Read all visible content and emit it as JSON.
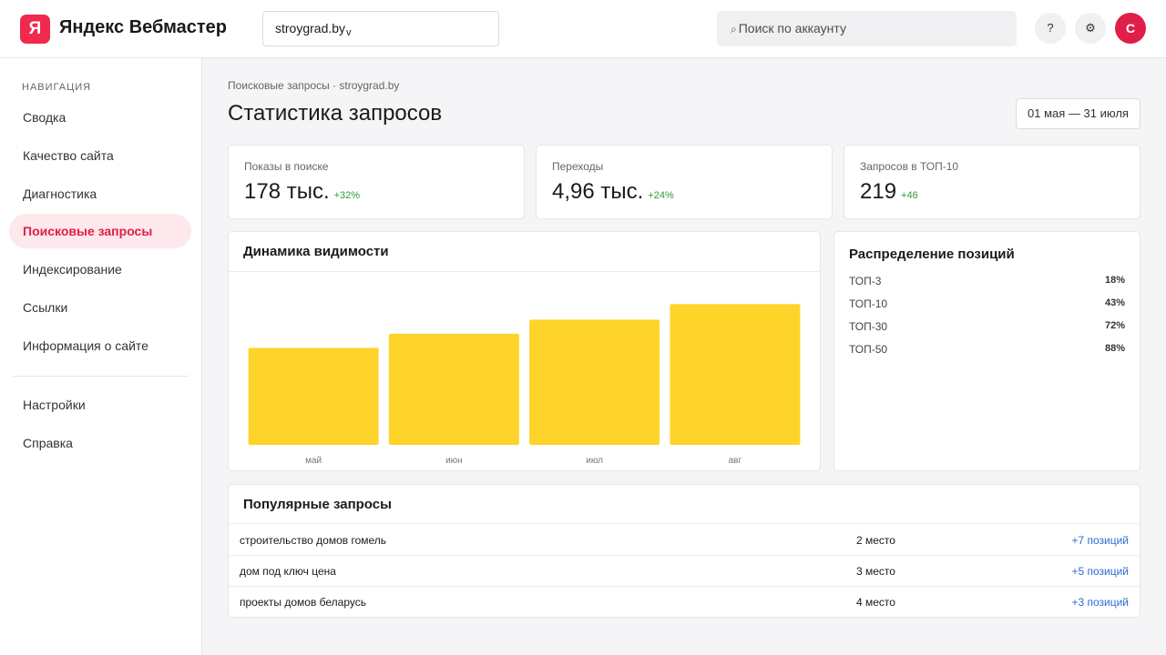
{
  "header": {
    "logo_letter": "Я",
    "app_title": "Яндекс Вебмастер",
    "site": "stroygrad.by",
    "site_chevron": "v",
    "search_icon": "⌕",
    "search_placeholder": "Поиск по аккаунту",
    "help_label": "?",
    "settings_icon": "⚙",
    "avatar_letter": "С"
  },
  "sidebar": {
    "heading": "НАВИГАЦИЯ",
    "items": [
      {
        "label": "Сводка",
        "active": false
      },
      {
        "label": "Качество сайта",
        "active": false
      },
      {
        "label": "Диагностика",
        "active": false
      },
      {
        "label": "Поисковые запросы",
        "active": true
      },
      {
        "label": "Индексирование",
        "active": false
      },
      {
        "label": "Ссылки",
        "active": false
      },
      {
        "label": "Информация о сайте",
        "active": false
      }
    ],
    "bottom_items": [
      {
        "label": "Настройки"
      },
      {
        "label": "Справка"
      }
    ]
  },
  "main": {
    "breadcrumb": "Поисковые запросы · stroygrad.by",
    "title": "Статистика запросов",
    "date_range": "01 мая — 31 июля",
    "stats": [
      {
        "label": "Показы в поиске",
        "value": "178 тыс.",
        "delta": "+32%"
      },
      {
        "label": "Переходы",
        "value": "4,96 тыс.",
        "delta": "+24%"
      },
      {
        "label": "Запросов в ТОП-10",
        "value": "219",
        "delta": "+46"
      }
    ],
    "visibility_title": "Динамика видимости",
    "distribution": {
      "title": "Распределение позиций",
      "rows": [
        {
          "label": "ТОП-3",
          "pct": "18%"
        },
        {
          "label": "ТОП-10",
          "pct": "43%"
        },
        {
          "label": "ТОП-30",
          "pct": "72%"
        },
        {
          "label": "ТОП-50",
          "pct": "88%"
        }
      ]
    },
    "popular": {
      "title": "Популярные запросы",
      "rows": [
        {
          "query": "строительство домов гомель",
          "position": "2 место",
          "delta": "+7 позиций"
        },
        {
          "query": "дом под ключ цена",
          "position": "3 место",
          "delta": "+5 позиций"
        },
        {
          "query": "проекты домов беларусь",
          "position": "4 место",
          "delta": "+3 позиций"
        }
      ]
    }
  },
  "colors": {
    "brand": "#f0294d",
    "accent_active": "#e01f49",
    "bar": "#fed42b",
    "delta_green": "#2a9d3a",
    "link_blue": "#2e6ad1"
  },
  "chart_data": {
    "type": "bar",
    "categories": [
      "май",
      "июн",
      "июл",
      "авг"
    ],
    "values": [
      62,
      71,
      80,
      90
    ],
    "ylim": [
      0,
      100
    ],
    "grid": false,
    "xlabel": "",
    "ylabel": ""
  }
}
